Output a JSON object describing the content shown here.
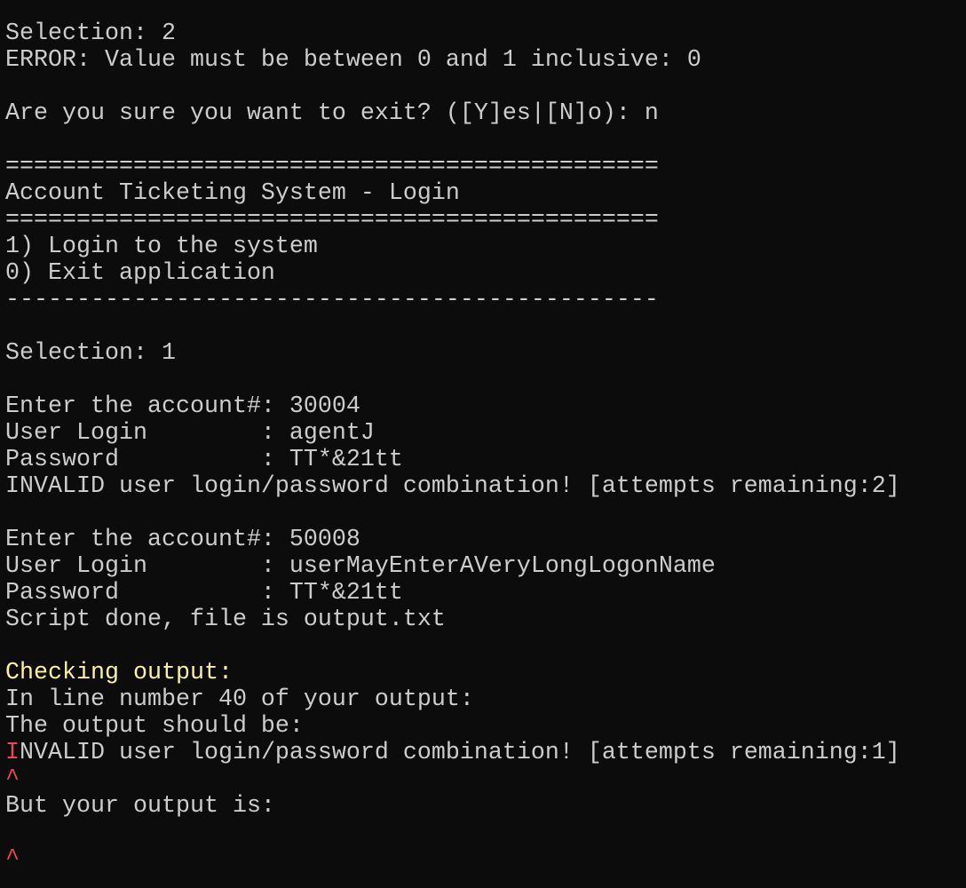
{
  "colors": {
    "text": "#cccccc",
    "highlight": "#f9f1a5",
    "error": "#e74856",
    "background": "#0c0c0c"
  },
  "session": {
    "selection_1": "Selection: 2",
    "error_range": "ERROR: Value must be between 0 and 1 inclusive: 0",
    "exit_prompt": "Are you sure you want to exit? ([Y]es|[N]o): n",
    "separator_double": "==============================================",
    "menu_title": "Account Ticketing System - Login",
    "menu_items": [
      "1) Login to the system",
      "0) Exit application"
    ],
    "separator_single": "----------------------------------------------",
    "selection_2": "Selection: 1",
    "attempts": [
      {
        "account": "Enter the account#: 30004",
        "login": "User Login        : agentJ",
        "password": "Password          : TT*&21tt",
        "result": "INVALID user login/password combination! [attempts remaining:2]"
      },
      {
        "account": "Enter the account#: 50008",
        "login": "User Login        : userMayEnterAVeryLongLogonName",
        "password": "Password          : TT*&21tt"
      }
    ],
    "script_done": "Script done, file is output.txt"
  },
  "checker": {
    "heading": "Checking output:",
    "line_info": "In line number 40 of your output:",
    "expected_label": "The output should be:",
    "expected_first_char": "I",
    "expected_rest": "NVALID user login/password combination! [attempts remaining:1]",
    "caret": "^",
    "actual_label": "But your output is:",
    "actual_value": "",
    "caret_2": "^"
  }
}
